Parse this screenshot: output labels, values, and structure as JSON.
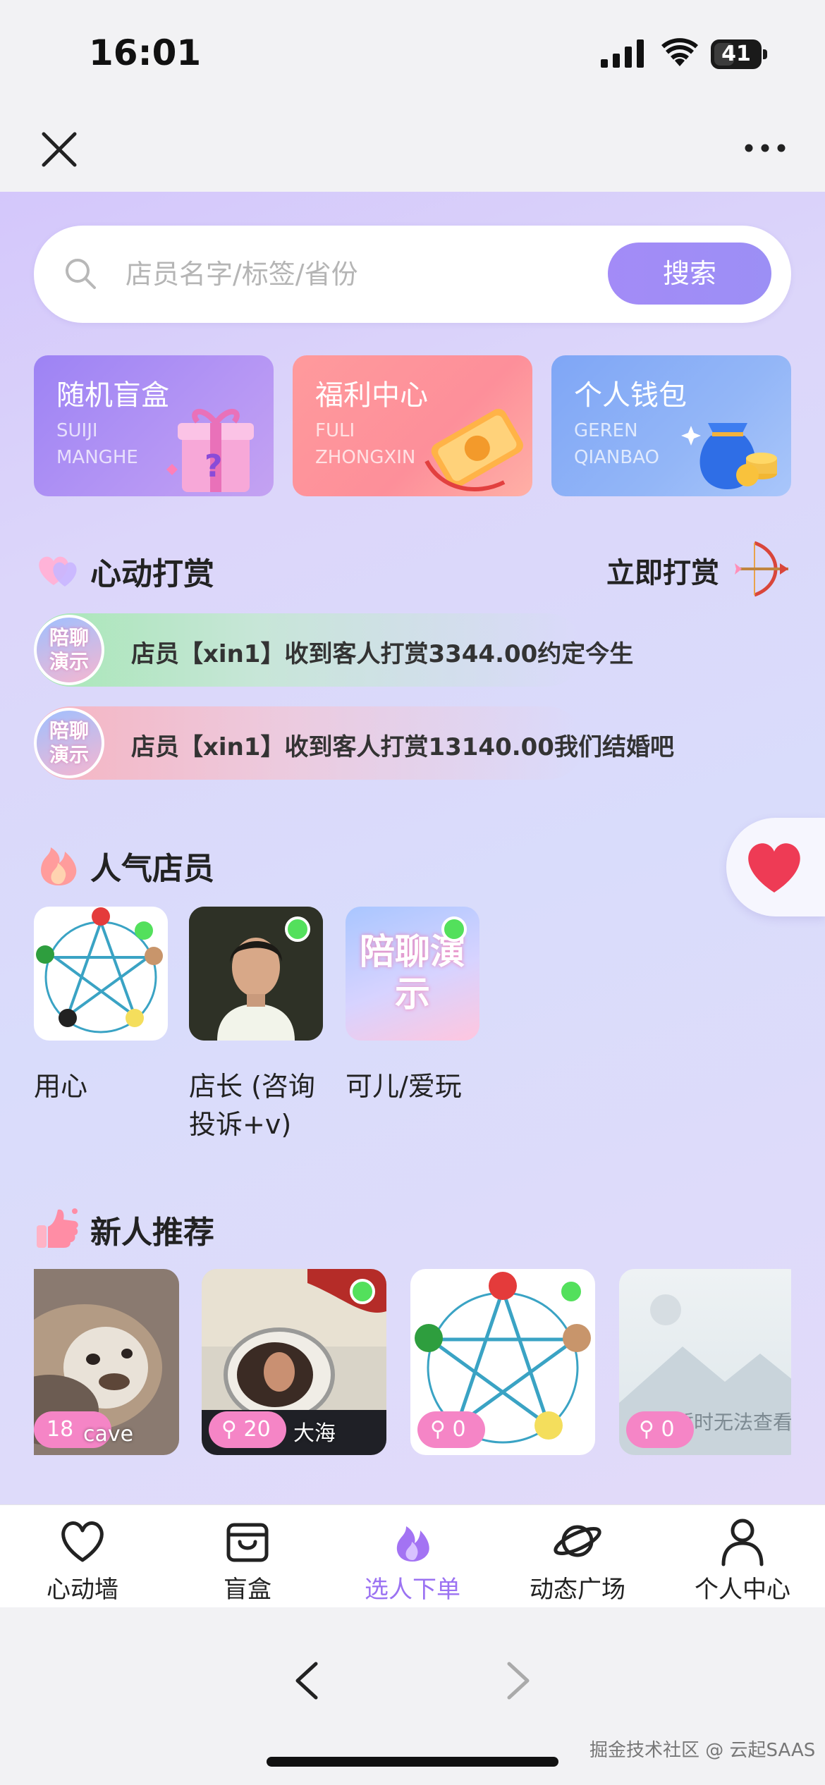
{
  "status_bar": {
    "time": "16:01",
    "battery": "41"
  },
  "search": {
    "placeholder": "店员名字/标签/省份",
    "button": "搜索"
  },
  "feature_cards": [
    {
      "title": "随机盲盒",
      "sub1": "SUIJI",
      "sub2": "MANGHE"
    },
    {
      "title": "福利中心",
      "sub1": "FULI",
      "sub2": "ZHONGXIN"
    },
    {
      "title": "个人钱包",
      "sub1": "GEREN",
      "sub2": "QIANBAO"
    }
  ],
  "tips": {
    "title": "心动打赏",
    "action": "立即打赏",
    "avatar_text": "陪聊演示",
    "items": [
      "店员【xin1】收到客人打赏3344.00约定今生",
      "店员【xin1】收到客人打赏13140.00我们结婚吧"
    ]
  },
  "popular": {
    "title": "人气店员",
    "items": [
      {
        "name": "用心",
        "online": false
      },
      {
        "name": "店长 (咨询投诉+v)",
        "online": true
      },
      {
        "name": "可儿/爱玩",
        "online": true,
        "thumb_text": "陪聊演示"
      }
    ]
  },
  "newbies": {
    "title": "新人推荐",
    "items": [
      {
        "badge": "18",
        "name": "cave"
      },
      {
        "badge": "20",
        "name": "大海",
        "online": true
      },
      {
        "badge": "0",
        "name": "",
        "online": true
      },
      {
        "badge": "0",
        "name": "",
        "overlay": "暂时无法查看"
      }
    ]
  },
  "tabbar": {
    "items": [
      {
        "label": "心动墙",
        "icon": "heart-icon"
      },
      {
        "label": "盲盒",
        "icon": "bag-icon"
      },
      {
        "label": "选人下单",
        "icon": "flame-icon",
        "active": true
      },
      {
        "label": "动态广场",
        "icon": "planet-icon"
      },
      {
        "label": "个人中心",
        "icon": "user-icon"
      }
    ]
  },
  "watermark": "掘金技术社区 @ 云起SAAS",
  "colors": {
    "accent": "#9b72f2",
    "search_button": "#a38bf7",
    "online": "#53e05c",
    "badge": "#f585c6"
  }
}
